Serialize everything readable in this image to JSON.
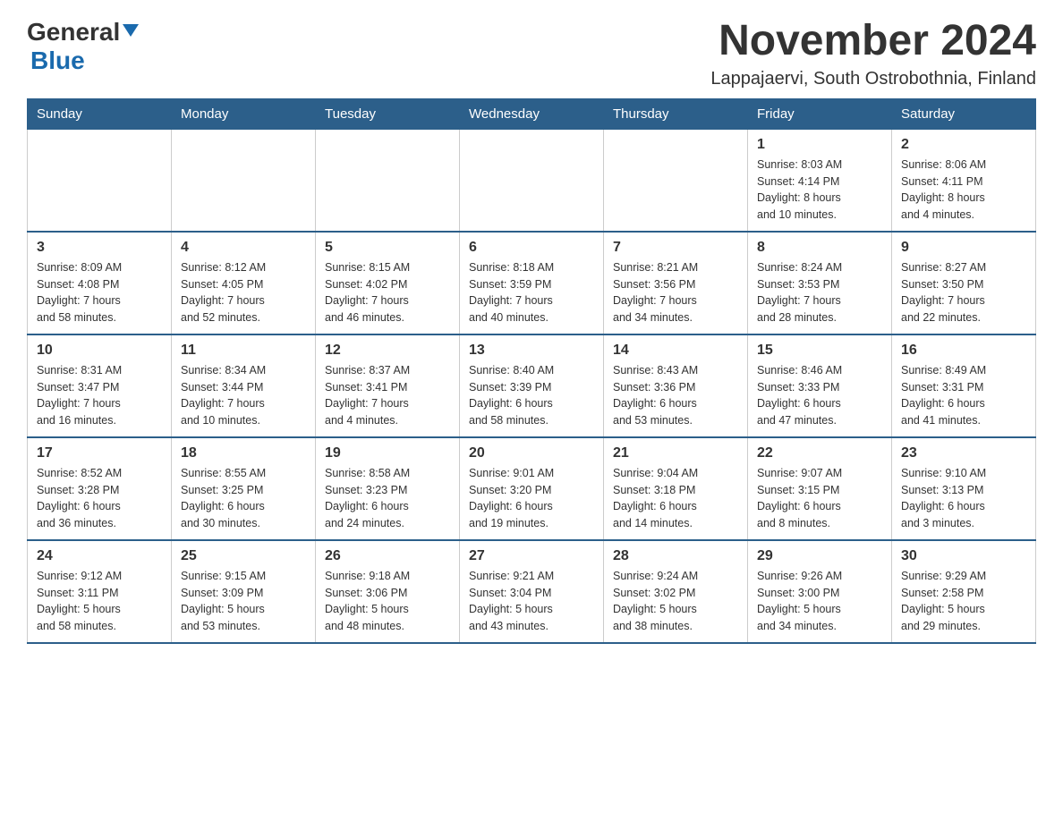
{
  "header": {
    "logo_general": "General",
    "logo_blue": "Blue",
    "month_title": "November 2024",
    "location": "Lappajaervi, South Ostrobothnia, Finland"
  },
  "weekdays": [
    "Sunday",
    "Monday",
    "Tuesday",
    "Wednesday",
    "Thursday",
    "Friday",
    "Saturday"
  ],
  "rows": [
    {
      "cells": [
        {
          "day": "",
          "info": ""
        },
        {
          "day": "",
          "info": ""
        },
        {
          "day": "",
          "info": ""
        },
        {
          "day": "",
          "info": ""
        },
        {
          "day": "",
          "info": ""
        },
        {
          "day": "1",
          "info": "Sunrise: 8:03 AM\nSunset: 4:14 PM\nDaylight: 8 hours\nand 10 minutes."
        },
        {
          "day": "2",
          "info": "Sunrise: 8:06 AM\nSunset: 4:11 PM\nDaylight: 8 hours\nand 4 minutes."
        }
      ]
    },
    {
      "cells": [
        {
          "day": "3",
          "info": "Sunrise: 8:09 AM\nSunset: 4:08 PM\nDaylight: 7 hours\nand 58 minutes."
        },
        {
          "day": "4",
          "info": "Sunrise: 8:12 AM\nSunset: 4:05 PM\nDaylight: 7 hours\nand 52 minutes."
        },
        {
          "day": "5",
          "info": "Sunrise: 8:15 AM\nSunset: 4:02 PM\nDaylight: 7 hours\nand 46 minutes."
        },
        {
          "day": "6",
          "info": "Sunrise: 8:18 AM\nSunset: 3:59 PM\nDaylight: 7 hours\nand 40 minutes."
        },
        {
          "day": "7",
          "info": "Sunrise: 8:21 AM\nSunset: 3:56 PM\nDaylight: 7 hours\nand 34 minutes."
        },
        {
          "day": "8",
          "info": "Sunrise: 8:24 AM\nSunset: 3:53 PM\nDaylight: 7 hours\nand 28 minutes."
        },
        {
          "day": "9",
          "info": "Sunrise: 8:27 AM\nSunset: 3:50 PM\nDaylight: 7 hours\nand 22 minutes."
        }
      ]
    },
    {
      "cells": [
        {
          "day": "10",
          "info": "Sunrise: 8:31 AM\nSunset: 3:47 PM\nDaylight: 7 hours\nand 16 minutes."
        },
        {
          "day": "11",
          "info": "Sunrise: 8:34 AM\nSunset: 3:44 PM\nDaylight: 7 hours\nand 10 minutes."
        },
        {
          "day": "12",
          "info": "Sunrise: 8:37 AM\nSunset: 3:41 PM\nDaylight: 7 hours\nand 4 minutes."
        },
        {
          "day": "13",
          "info": "Sunrise: 8:40 AM\nSunset: 3:39 PM\nDaylight: 6 hours\nand 58 minutes."
        },
        {
          "day": "14",
          "info": "Sunrise: 8:43 AM\nSunset: 3:36 PM\nDaylight: 6 hours\nand 53 minutes."
        },
        {
          "day": "15",
          "info": "Sunrise: 8:46 AM\nSunset: 3:33 PM\nDaylight: 6 hours\nand 47 minutes."
        },
        {
          "day": "16",
          "info": "Sunrise: 8:49 AM\nSunset: 3:31 PM\nDaylight: 6 hours\nand 41 minutes."
        }
      ]
    },
    {
      "cells": [
        {
          "day": "17",
          "info": "Sunrise: 8:52 AM\nSunset: 3:28 PM\nDaylight: 6 hours\nand 36 minutes."
        },
        {
          "day": "18",
          "info": "Sunrise: 8:55 AM\nSunset: 3:25 PM\nDaylight: 6 hours\nand 30 minutes."
        },
        {
          "day": "19",
          "info": "Sunrise: 8:58 AM\nSunset: 3:23 PM\nDaylight: 6 hours\nand 24 minutes."
        },
        {
          "day": "20",
          "info": "Sunrise: 9:01 AM\nSunset: 3:20 PM\nDaylight: 6 hours\nand 19 minutes."
        },
        {
          "day": "21",
          "info": "Sunrise: 9:04 AM\nSunset: 3:18 PM\nDaylight: 6 hours\nand 14 minutes."
        },
        {
          "day": "22",
          "info": "Sunrise: 9:07 AM\nSunset: 3:15 PM\nDaylight: 6 hours\nand 8 minutes."
        },
        {
          "day": "23",
          "info": "Sunrise: 9:10 AM\nSunset: 3:13 PM\nDaylight: 6 hours\nand 3 minutes."
        }
      ]
    },
    {
      "cells": [
        {
          "day": "24",
          "info": "Sunrise: 9:12 AM\nSunset: 3:11 PM\nDaylight: 5 hours\nand 58 minutes."
        },
        {
          "day": "25",
          "info": "Sunrise: 9:15 AM\nSunset: 3:09 PM\nDaylight: 5 hours\nand 53 minutes."
        },
        {
          "day": "26",
          "info": "Sunrise: 9:18 AM\nSunset: 3:06 PM\nDaylight: 5 hours\nand 48 minutes."
        },
        {
          "day": "27",
          "info": "Sunrise: 9:21 AM\nSunset: 3:04 PM\nDaylight: 5 hours\nand 43 minutes."
        },
        {
          "day": "28",
          "info": "Sunrise: 9:24 AM\nSunset: 3:02 PM\nDaylight: 5 hours\nand 38 minutes."
        },
        {
          "day": "29",
          "info": "Sunrise: 9:26 AM\nSunset: 3:00 PM\nDaylight: 5 hours\nand 34 minutes."
        },
        {
          "day": "30",
          "info": "Sunrise: 9:29 AM\nSunset: 2:58 PM\nDaylight: 5 hours\nand 29 minutes."
        }
      ]
    }
  ]
}
